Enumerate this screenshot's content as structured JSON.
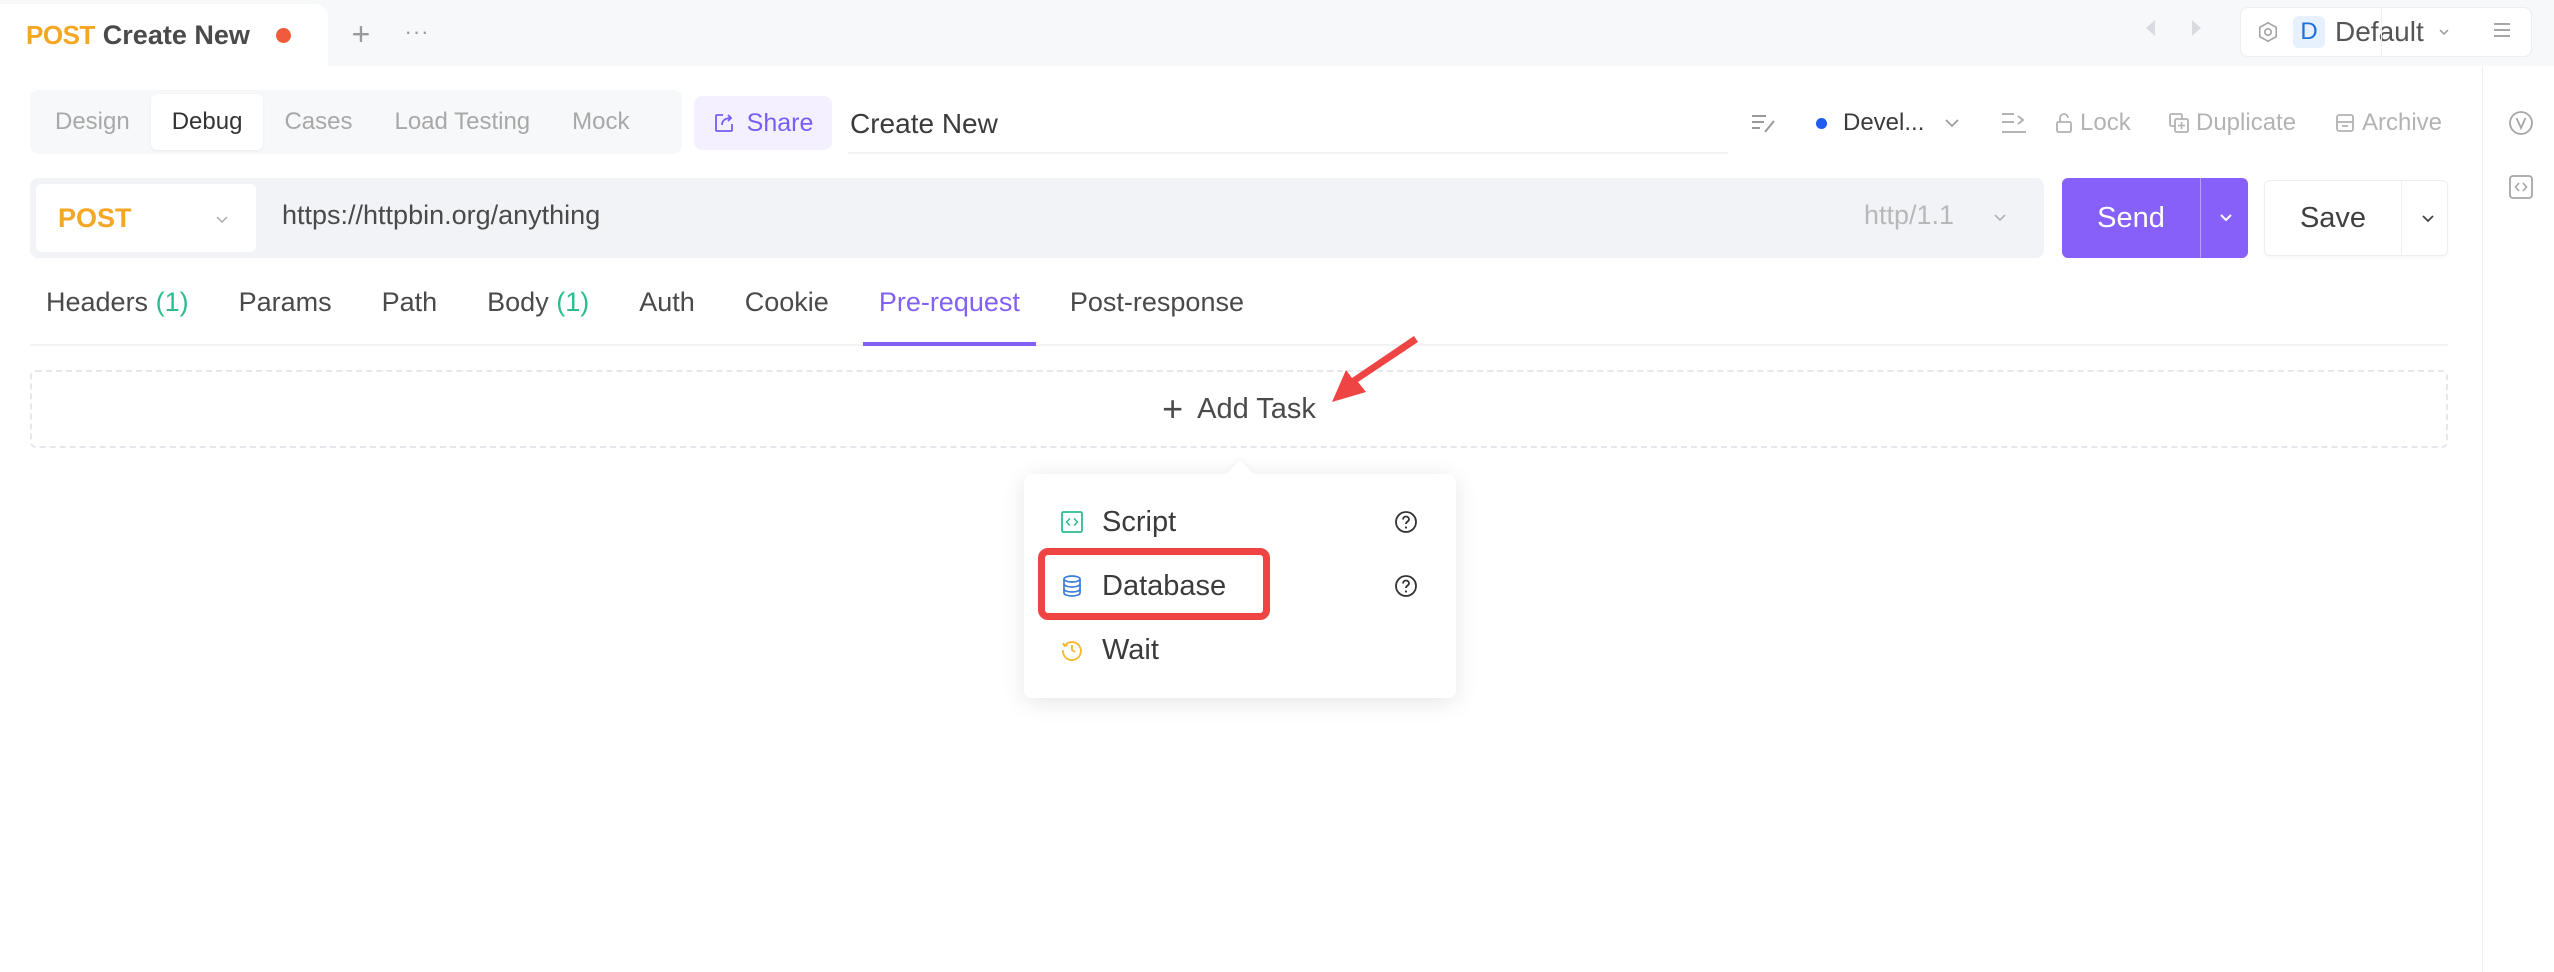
{
  "doc_tab": {
    "method": "POST",
    "name": "Create New",
    "unsaved": true
  },
  "tab_actions": {
    "add_label": "+",
    "more_label": "···"
  },
  "environment": {
    "badge": "D",
    "name": "Default"
  },
  "mode_tabs": [
    {
      "label": "Design",
      "active": false
    },
    {
      "label": "Debug",
      "active": true
    },
    {
      "label": "Cases",
      "active": false
    },
    {
      "label": "Load Testing",
      "active": false
    },
    {
      "label": "Mock",
      "active": false
    }
  ],
  "share": {
    "label": "Share"
  },
  "title_input": {
    "value": "Create New"
  },
  "toolbar": {
    "status": "Devel...",
    "status_color": "#1f5cf0",
    "lock": "Lock",
    "duplicate": "Duplicate",
    "archive": "Archive"
  },
  "request": {
    "method": "POST",
    "url": "https://httpbin.org/anything",
    "protocol": "http/1.1",
    "send_label": "Send",
    "save_label": "Save"
  },
  "request_tabs": [
    {
      "label": "Headers",
      "count": "(1)",
      "active": false
    },
    {
      "label": "Params",
      "count": "",
      "active": false
    },
    {
      "label": "Path",
      "count": "",
      "active": false
    },
    {
      "label": "Body",
      "count": "(1)",
      "active": false
    },
    {
      "label": "Auth",
      "count": "",
      "active": false
    },
    {
      "label": "Cookie",
      "count": "",
      "active": false
    },
    {
      "label": "Pre-request",
      "count": "",
      "active": true
    },
    {
      "label": "Post-response",
      "count": "",
      "active": false
    }
  ],
  "add_task": {
    "label": "Add Task"
  },
  "task_menu": [
    {
      "label": "Script",
      "icon": "code-icon",
      "color": "#2bbd91",
      "help": true
    },
    {
      "label": "Database",
      "icon": "database-icon",
      "color": "#3b7ddd",
      "help": true
    },
    {
      "label": "Wait",
      "icon": "history-clock-icon",
      "color": "#f5b82e",
      "help": false
    }
  ],
  "colors": {
    "accent": "#8760fa",
    "post": "#f5a623",
    "annotation": "#ef4444"
  }
}
